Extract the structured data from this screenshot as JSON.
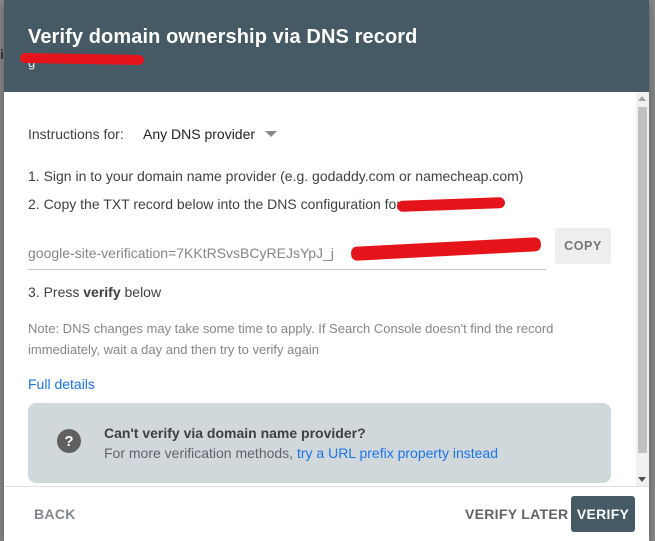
{
  "background": {
    "letter": "i"
  },
  "dialog": {
    "title": "Verify domain ownership via DNS record",
    "subtitle": "g",
    "instructions_label": "Instructions for:",
    "provider_selected": "Any DNS provider",
    "step1": "1. Sign in to your domain name provider (e.g. godaddy.com or namecheap.com)",
    "step2": "2. Copy the TXT record below into the DNS configuration for",
    "txt_record": "google-site-verification=7KKtRSvsBCyREJsYpJ_j",
    "copy_label": "COPY",
    "step3_prefix": "3. Press ",
    "step3_bold": "verify",
    "step3_suffix": " below",
    "note": "Note: DNS changes may take some time to apply. If Search Console doesn't find the record immediately, wait a day and then try to verify again",
    "full_details": "Full details",
    "info_title": "Can't verify via domain name provider?",
    "info_text": "For more verification methods, ",
    "info_link": "try a URL prefix property instead",
    "help_icon_glyph": "?"
  },
  "footer": {
    "back": "BACK",
    "verify_later": "VERIFY LATER",
    "verify": "VERIFY"
  },
  "colors": {
    "header": "#455a64",
    "link": "#1a73e8",
    "info_box": "#d1d8dc",
    "redaction": "#e5141b"
  },
  "icons": [
    "dropdown-caret-icon",
    "help-circle-icon",
    "scroll-up-icon",
    "scroll-down-icon"
  ]
}
